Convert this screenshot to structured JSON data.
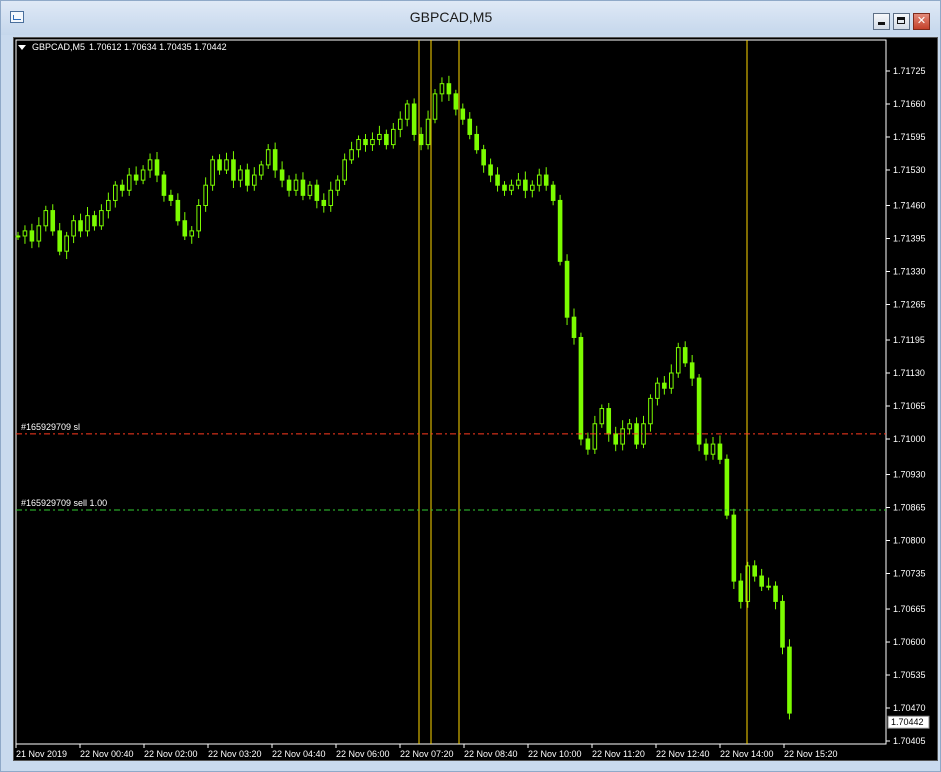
{
  "window": {
    "title": "GBPCAD,M5",
    "controls": {
      "minimize": "minimize",
      "maximize": "maximize",
      "close": "✕"
    }
  },
  "chart_header": {
    "symbol": "GBPCAD,M5",
    "ohlc": "1.70612 1.70634 1.70435 1.70442"
  },
  "colors": {
    "background": "#000000",
    "candle": "#7CFC00",
    "vline": "#FFD700",
    "sl_line": "#FF3B1F",
    "entry_line": "#32CD32",
    "axis": "#FFFFFF"
  },
  "orders": {
    "sl": {
      "label": "#165929709 sl",
      "price": 1.7101
    },
    "entry": {
      "label": "#165929709 sell 1.00",
      "price": 1.7086
    }
  },
  "current_price": "1.70442",
  "chart_data": {
    "type": "candlestick",
    "y_ticks": [
      "1.71725",
      "1.71660",
      "1.71595",
      "1.71530",
      "1.71460",
      "1.71395",
      "1.71330",
      "1.71265",
      "1.71195",
      "1.71130",
      "1.71065",
      "1.71000",
      "1.70930",
      "1.70865",
      "1.70800",
      "1.70735",
      "1.70665",
      "1.70600",
      "1.70535",
      "1.70470",
      "1.70405"
    ],
    "x_ticks": [
      "21 Nov 2019",
      "22 Nov 00:40",
      "22 Nov 02:00",
      "22 Nov 03:20",
      "22 Nov 04:40",
      "22 Nov 06:00",
      "22 Nov 07:20",
      "22 Nov 08:40",
      "22 Nov 10:00",
      "22 Nov 11:20",
      "22 Nov 12:40",
      "22 Nov 14:00",
      "22 Nov 15:20"
    ],
    "ylim": [
      1.70405,
      1.71725
    ],
    "vertical_lines_time": [
      "22 Nov 07:20",
      "22 Nov 07:35",
      "22 Nov 08:10",
      "22 Nov 14:00"
    ],
    "close_path": [
      1.714,
      1.7141,
      1.7139,
      1.7142,
      1.7145,
      1.7141,
      1.7137,
      1.714,
      1.7143,
      1.7141,
      1.7144,
      1.7142,
      1.7145,
      1.7147,
      1.715,
      1.7149,
      1.7152,
      1.7151,
      1.7153,
      1.7155,
      1.7152,
      1.7148,
      1.7147,
      1.7143,
      1.714,
      1.7141,
      1.7146,
      1.715,
      1.7155,
      1.7153,
      1.7155,
      1.7151,
      1.7153,
      1.715,
      1.7152,
      1.7154,
      1.7157,
      1.7153,
      1.7151,
      1.7149,
      1.7151,
      1.7148,
      1.715,
      1.7147,
      1.7146,
      1.7149,
      1.7151,
      1.7155,
      1.7157,
      1.7159,
      1.7158,
      1.7159,
      1.716,
      1.7158,
      1.7161,
      1.7163,
      1.7166,
      1.716,
      1.7158,
      1.7163,
      1.7168,
      1.717,
      1.7168,
      1.7165,
      1.7163,
      1.716,
      1.7157,
      1.7154,
      1.7152,
      1.715,
      1.7149,
      1.715,
      1.7151,
      1.7149,
      1.715,
      1.7152,
      1.715,
      1.7147,
      1.7135,
      1.7124,
      1.712,
      1.71,
      1.7098,
      1.7103,
      1.7106,
      1.7101,
      1.7099,
      1.7102,
      1.7103,
      1.7099,
      1.7103,
      1.7108,
      1.7111,
      1.711,
      1.7113,
      1.7118,
      1.7115,
      1.7112,
      1.7099,
      1.7097,
      1.7099,
      1.7096,
      1.7085,
      1.7072,
      1.7068,
      1.7075,
      1.7073,
      1.7071,
      1.7071,
      1.7068,
      1.7059,
      1.7046
    ]
  }
}
